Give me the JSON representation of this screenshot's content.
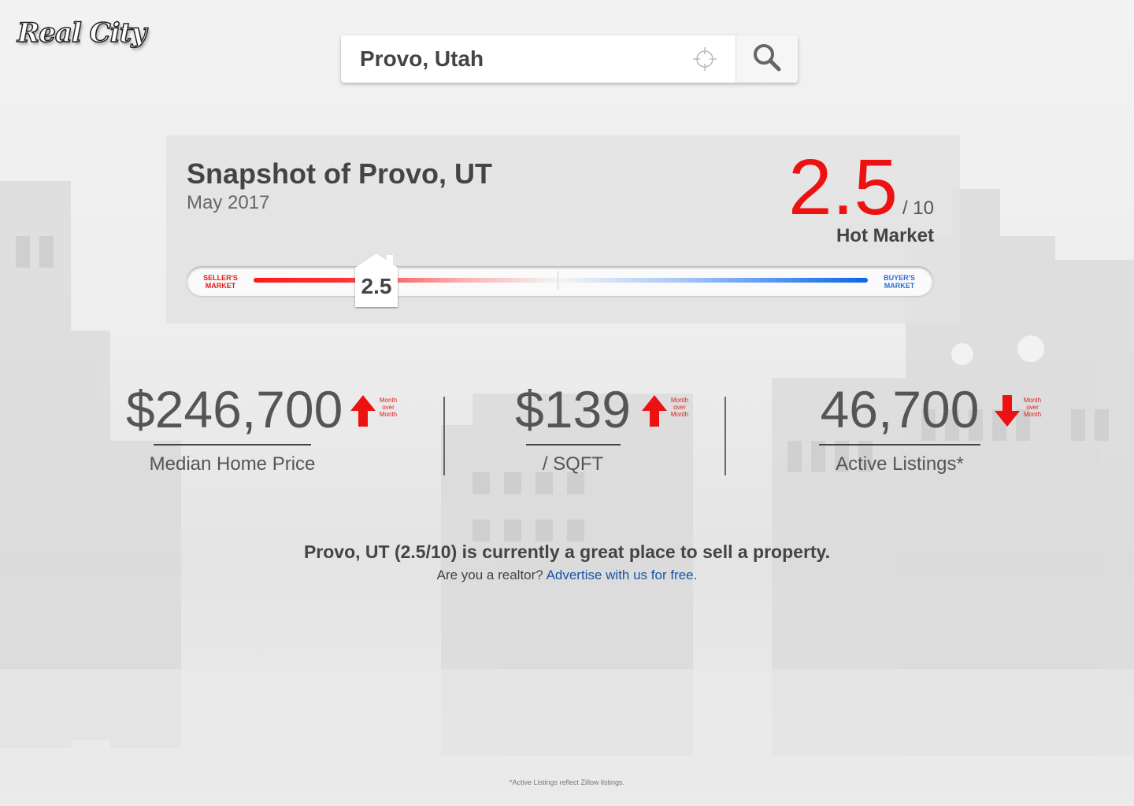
{
  "brand": {
    "logo_text": "Real City"
  },
  "search": {
    "value": "Provo, Utah",
    "locate_icon": "crosshair-icon",
    "search_icon": "magnifier-icon"
  },
  "snapshot": {
    "title": "Snapshot of Provo, UT",
    "date": "May 2017",
    "score": "2.5",
    "score_out_of": "/ 10",
    "market_label": "Hot Market",
    "slider": {
      "left_label_line1": "SELLER'S",
      "left_label_line2": "MARKET",
      "right_label_line1": "BUYER'S",
      "right_label_line2": "MARKET",
      "marker_value": "2.5",
      "position_fraction": 0.25
    },
    "colors": {
      "score": "#ee1111",
      "seller": "#e21b1b",
      "buyer": "#2c6fd8"
    }
  },
  "stats": [
    {
      "value": "$246,700",
      "label": "Median Home Price",
      "trend": "up",
      "trend_line1": "Month",
      "trend_line2": "over",
      "trend_line3": "Month"
    },
    {
      "value": "$139",
      "label": "/ SQFT",
      "trend": "up",
      "trend_line1": "Month",
      "trend_line2": "over",
      "trend_line3": "Month"
    },
    {
      "value": "46,700",
      "label": "Active Listings*",
      "trend": "down",
      "trend_line1": "Month",
      "trend_line2": "over",
      "trend_line3": "Month"
    }
  ],
  "summary": {
    "main": "Provo, UT (2.5/10) is currently a great place to sell a property.",
    "realtor_prompt": "Are you a realtor?",
    "advertise_link": "Advertise with us for free",
    "period": "."
  },
  "footnote": "*Active Listings reflect Zillow listings."
}
